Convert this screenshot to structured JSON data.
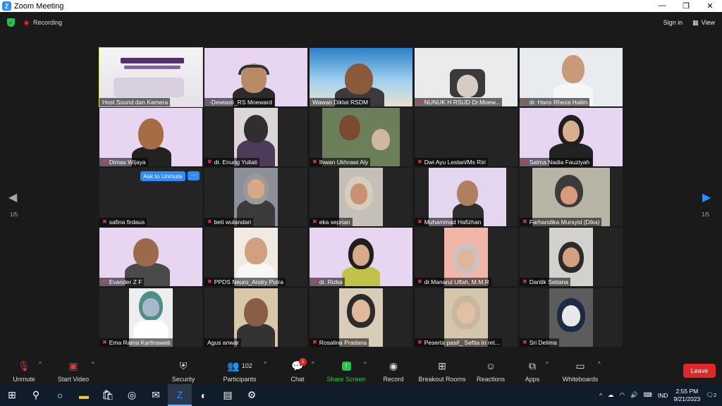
{
  "window": {
    "title": "Zoom Meeting",
    "min": "—",
    "max": "❐",
    "close": "✕"
  },
  "topbar": {
    "recording": "Recording",
    "sign_in": "Sign in",
    "view": "View"
  },
  "page": {
    "left": "1/5",
    "right": "1/5"
  },
  "ask_unmute": "Ask to Unmute",
  "more_label": "···",
  "participants": [
    {
      "name": "Host Sound dan Kamera",
      "muted": false
    },
    {
      "name": "-Dewiasti_RS Moeward",
      "muted": false
    },
    {
      "name": "Wawan Diklat RSDM",
      "muted": false
    },
    {
      "name": "NUNUK H RSUD Dr.Moew...",
      "muted": true
    },
    {
      "name": "dr. Hans Rheza Halim",
      "muted": true
    },
    {
      "name": "Dimas Wijaya",
      "muted": true
    },
    {
      "name": "dr. Enung Yuliati",
      "muted": true
    },
    {
      "name": "Ihwan Ukhrawi Aly",
      "muted": true
    },
    {
      "name": "Dwi Ayu Lestari/Ms Riri",
      "muted": true
    },
    {
      "name": "Salma Nadia Fauziyah",
      "muted": true
    },
    {
      "name": "safina firdaus",
      "muted": true
    },
    {
      "name": "beti wulandari",
      "muted": true
    },
    {
      "name": "eka seprian",
      "muted": true
    },
    {
      "name": "Muhammad Hafizhan",
      "muted": true
    },
    {
      "name": "Farhandika Mursyid (Dika)",
      "muted": true
    },
    {
      "name": "Evander Z F",
      "muted": true
    },
    {
      "name": "PPDS Neuro_Andry Putra",
      "muted": true
    },
    {
      "name": "dr. Rizka",
      "muted": true
    },
    {
      "name": "dr.Manarul Ulfah, M.M.R",
      "muted": true
    },
    {
      "name": "Dantik Setiana",
      "muted": true
    },
    {
      "name": "Ema Ratna Kartinawati",
      "muted": true
    },
    {
      "name": "Agus anwar",
      "muted": false
    },
    {
      "name": "Rosalina Pradana",
      "muted": true
    },
    {
      "name": "Peserta pasif_ Seftia tri ret...",
      "muted": true
    },
    {
      "name": "Sri Delima",
      "muted": true
    }
  ],
  "toolbar": {
    "unmute": "Unmute",
    "start_video": "Start Video",
    "security": "Security",
    "participants": "Participants",
    "participant_count": "102",
    "chat": "Chat",
    "chat_badge": "1",
    "share_screen": "Share Screen",
    "record": "Record",
    "breakout": "Breakout Rooms",
    "reactions": "Reactions",
    "apps": "Apps",
    "whiteboards": "Whiteboards",
    "leave": "Leave"
  },
  "taskbar": {
    "lang": "IND",
    "time": "2:55 PM",
    "date": "9/21/2023",
    "notif": "2"
  }
}
